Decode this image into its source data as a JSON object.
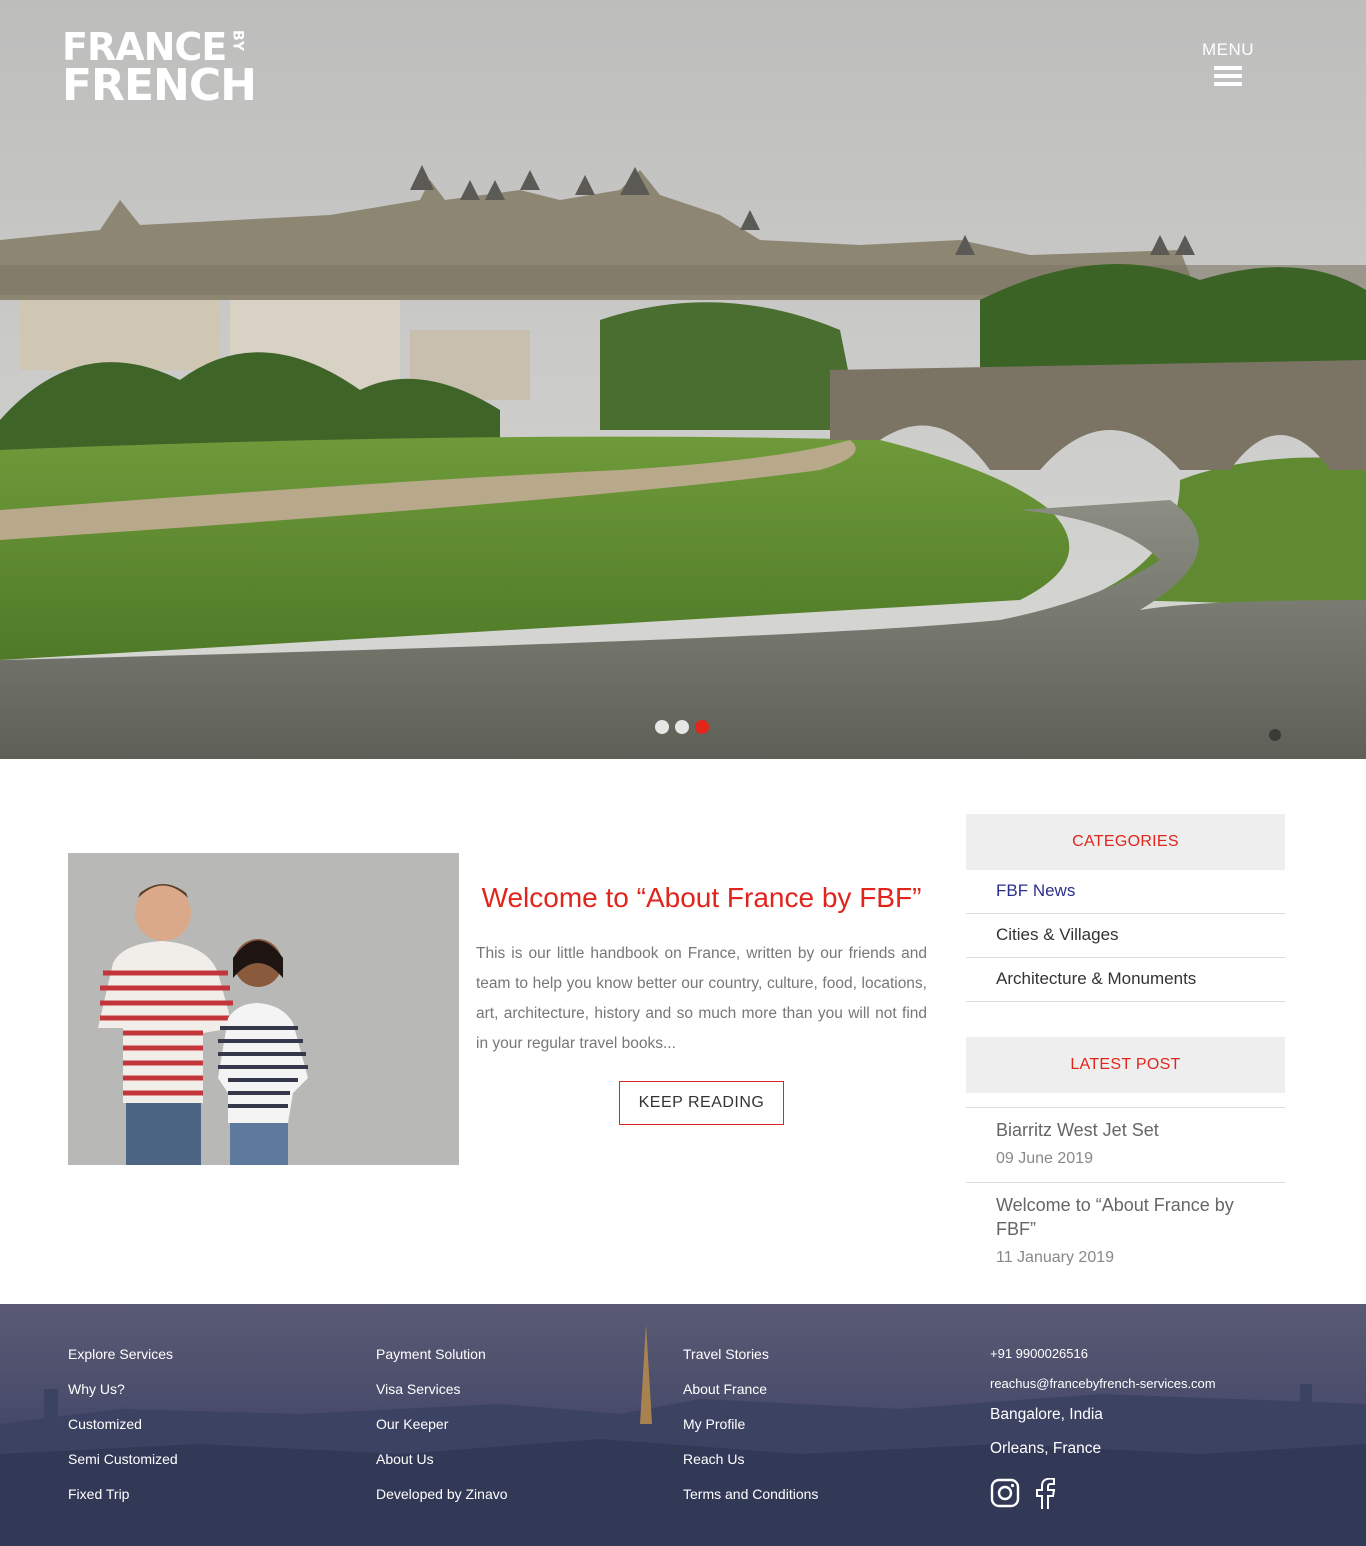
{
  "brand": {
    "line1": "FRANCE",
    "by": "BY",
    "line2": "FRENCH"
  },
  "header": {
    "menu_label": "MENU"
  },
  "slider": {
    "slides": 3,
    "active": 3
  },
  "intro": {
    "title": "Welcome to “About France by FBF”",
    "body": "This is our little handbook on France, written by our friends and team to help you know better our country, culture, food, locations, art, architecture, history and so much more than you will not find in your regular travel books...",
    "button": "KEEP READING"
  },
  "sidebar": {
    "categories_title": "CATEGORIES",
    "categories": [
      "FBF News",
      "Cities & Villages",
      "Architecture & Monuments"
    ],
    "latest_title": "LATEST POST",
    "posts": [
      {
        "title": "Biarritz West Jet Set",
        "date": "09 June 2019"
      },
      {
        "title": "Welcome to “About France by FBF”",
        "date": "11 January 2019"
      }
    ]
  },
  "footer": {
    "col1": [
      "Explore Services",
      "Why Us?",
      "Customized",
      "Semi Customized",
      "Fixed Trip"
    ],
    "col2": [
      "Payment Solution",
      "Visa Services",
      "Our Keeper",
      "About Us",
      "Developed by Zinavo"
    ],
    "col3": [
      "Travel Stories",
      "About France",
      "My Profile",
      "Reach Us",
      "Terms and Conditions"
    ],
    "contact": {
      "phone": "+91 9900026516",
      "email": "reachus@francebyfrench-services.com",
      "office1": "Bangalore, India",
      "office2": "Orleans, France"
    },
    "social": [
      "instagram-icon",
      "facebook-icon"
    ]
  },
  "colors": {
    "accent": "#e0251c",
    "link": "#2b2f8c",
    "panel": "#eeeeee"
  }
}
